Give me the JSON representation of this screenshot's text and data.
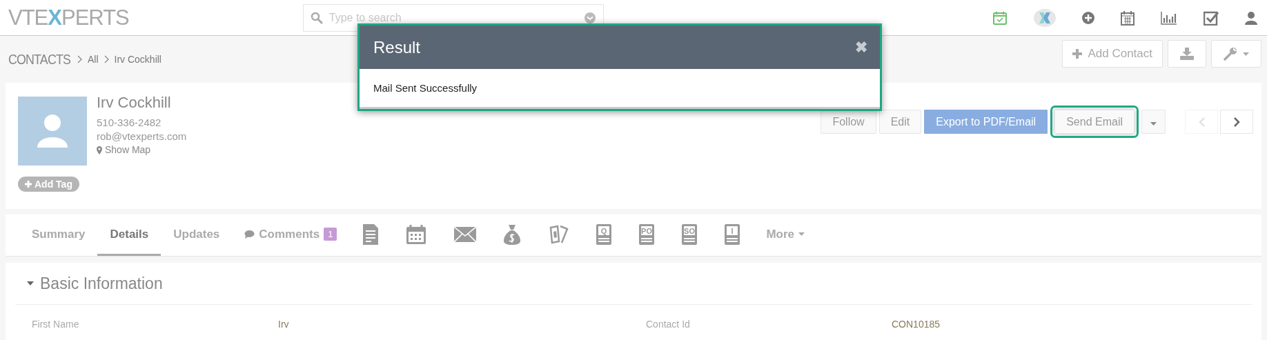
{
  "header": {
    "logo": [
      "VTE",
      "X",
      "PERTS"
    ],
    "search": {
      "placeholder": "Type to search"
    }
  },
  "breadcrumb": {
    "module": "CONTACTS",
    "items": [
      "All",
      "Irv Cockhill"
    ]
  },
  "page_actions": {
    "add_label": "Add Contact"
  },
  "contact": {
    "name": "Irv Cockhill",
    "phone": "510-336-2482",
    "email": "rob@vtexperts.com",
    "map_link": "Show Map",
    "tag_button": "Add Tag"
  },
  "actions": [
    {
      "label": "Follow",
      "kind": "default",
      "highlighted": false
    },
    {
      "label": "Edit",
      "kind": "default",
      "highlighted": false
    },
    {
      "label": "Export to PDF/Email",
      "kind": "primary",
      "highlighted": false
    },
    {
      "label": "Send Email",
      "kind": "default",
      "highlighted": true
    }
  ],
  "record_nav": {
    "previous_disabled": true,
    "next_disabled": false
  },
  "tabs": [
    {
      "kind": "text",
      "label": "Summary",
      "selected": false
    },
    {
      "kind": "text",
      "label": "Details",
      "selected": true
    },
    {
      "kind": "text",
      "label": "Updates",
      "selected": false
    },
    {
      "kind": "comments",
      "label": "Comments",
      "badge": "1",
      "selected": false
    },
    {
      "kind": "icon",
      "selected": false
    },
    {
      "kind": "icon",
      "selected": false
    },
    {
      "kind": "icon",
      "selected": false
    },
    {
      "kind": "icon",
      "selected": false
    },
    {
      "kind": "icon",
      "selected": false
    },
    {
      "kind": "doc",
      "glyph": "Q",
      "selected": false
    },
    {
      "kind": "doc",
      "glyph": "PO",
      "selected": false
    },
    {
      "kind": "doc",
      "glyph": "SO",
      "selected": false
    },
    {
      "kind": "doc",
      "glyph": "I",
      "selected": false
    },
    {
      "kind": "more",
      "label": "More",
      "selected": false
    }
  ],
  "section": {
    "title": "Basic Information",
    "expanded": true,
    "fields": [
      {
        "label": "First Name",
        "value": "Irv"
      },
      {
        "label": "Contact Id",
        "value": "CON10185"
      }
    ]
  },
  "dialog": {
    "title": "Result",
    "close": "✖",
    "message": "Mail Sent Successfully",
    "highlighted": true
  }
}
